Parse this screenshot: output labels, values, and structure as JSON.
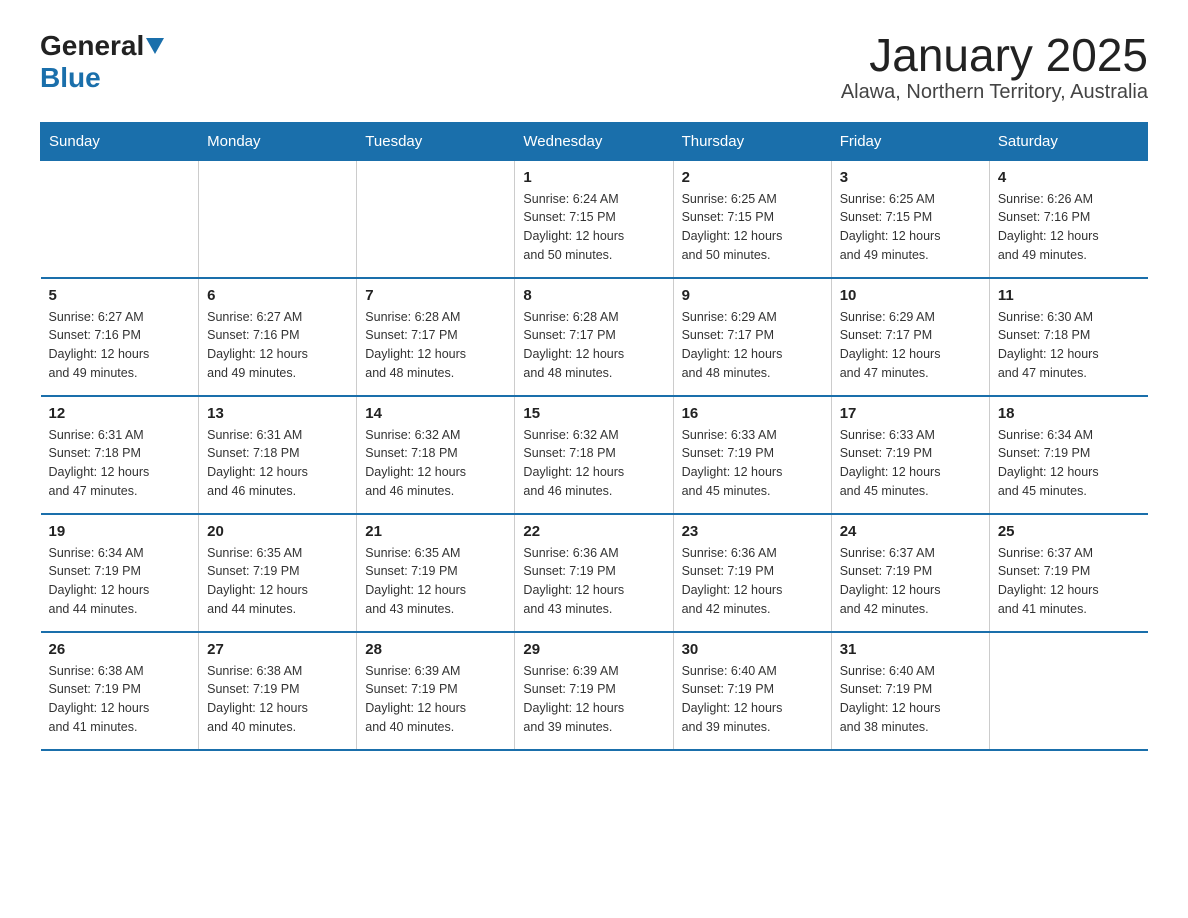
{
  "header": {
    "logo_general": "General",
    "logo_blue": "Blue",
    "title": "January 2025",
    "subtitle": "Alawa, Northern Territory, Australia"
  },
  "days_of_week": [
    "Sunday",
    "Monday",
    "Tuesday",
    "Wednesday",
    "Thursday",
    "Friday",
    "Saturday"
  ],
  "weeks": [
    [
      {
        "day": "",
        "info": ""
      },
      {
        "day": "",
        "info": ""
      },
      {
        "day": "",
        "info": ""
      },
      {
        "day": "1",
        "info": "Sunrise: 6:24 AM\nSunset: 7:15 PM\nDaylight: 12 hours\nand 50 minutes."
      },
      {
        "day": "2",
        "info": "Sunrise: 6:25 AM\nSunset: 7:15 PM\nDaylight: 12 hours\nand 50 minutes."
      },
      {
        "day": "3",
        "info": "Sunrise: 6:25 AM\nSunset: 7:15 PM\nDaylight: 12 hours\nand 49 minutes."
      },
      {
        "day": "4",
        "info": "Sunrise: 6:26 AM\nSunset: 7:16 PM\nDaylight: 12 hours\nand 49 minutes."
      }
    ],
    [
      {
        "day": "5",
        "info": "Sunrise: 6:27 AM\nSunset: 7:16 PM\nDaylight: 12 hours\nand 49 minutes."
      },
      {
        "day": "6",
        "info": "Sunrise: 6:27 AM\nSunset: 7:16 PM\nDaylight: 12 hours\nand 49 minutes."
      },
      {
        "day": "7",
        "info": "Sunrise: 6:28 AM\nSunset: 7:17 PM\nDaylight: 12 hours\nand 48 minutes."
      },
      {
        "day": "8",
        "info": "Sunrise: 6:28 AM\nSunset: 7:17 PM\nDaylight: 12 hours\nand 48 minutes."
      },
      {
        "day": "9",
        "info": "Sunrise: 6:29 AM\nSunset: 7:17 PM\nDaylight: 12 hours\nand 48 minutes."
      },
      {
        "day": "10",
        "info": "Sunrise: 6:29 AM\nSunset: 7:17 PM\nDaylight: 12 hours\nand 47 minutes."
      },
      {
        "day": "11",
        "info": "Sunrise: 6:30 AM\nSunset: 7:18 PM\nDaylight: 12 hours\nand 47 minutes."
      }
    ],
    [
      {
        "day": "12",
        "info": "Sunrise: 6:31 AM\nSunset: 7:18 PM\nDaylight: 12 hours\nand 47 minutes."
      },
      {
        "day": "13",
        "info": "Sunrise: 6:31 AM\nSunset: 7:18 PM\nDaylight: 12 hours\nand 46 minutes."
      },
      {
        "day": "14",
        "info": "Sunrise: 6:32 AM\nSunset: 7:18 PM\nDaylight: 12 hours\nand 46 minutes."
      },
      {
        "day": "15",
        "info": "Sunrise: 6:32 AM\nSunset: 7:18 PM\nDaylight: 12 hours\nand 46 minutes."
      },
      {
        "day": "16",
        "info": "Sunrise: 6:33 AM\nSunset: 7:19 PM\nDaylight: 12 hours\nand 45 minutes."
      },
      {
        "day": "17",
        "info": "Sunrise: 6:33 AM\nSunset: 7:19 PM\nDaylight: 12 hours\nand 45 minutes."
      },
      {
        "day": "18",
        "info": "Sunrise: 6:34 AM\nSunset: 7:19 PM\nDaylight: 12 hours\nand 45 minutes."
      }
    ],
    [
      {
        "day": "19",
        "info": "Sunrise: 6:34 AM\nSunset: 7:19 PM\nDaylight: 12 hours\nand 44 minutes."
      },
      {
        "day": "20",
        "info": "Sunrise: 6:35 AM\nSunset: 7:19 PM\nDaylight: 12 hours\nand 44 minutes."
      },
      {
        "day": "21",
        "info": "Sunrise: 6:35 AM\nSunset: 7:19 PM\nDaylight: 12 hours\nand 43 minutes."
      },
      {
        "day": "22",
        "info": "Sunrise: 6:36 AM\nSunset: 7:19 PM\nDaylight: 12 hours\nand 43 minutes."
      },
      {
        "day": "23",
        "info": "Sunrise: 6:36 AM\nSunset: 7:19 PM\nDaylight: 12 hours\nand 42 minutes."
      },
      {
        "day": "24",
        "info": "Sunrise: 6:37 AM\nSunset: 7:19 PM\nDaylight: 12 hours\nand 42 minutes."
      },
      {
        "day": "25",
        "info": "Sunrise: 6:37 AM\nSunset: 7:19 PM\nDaylight: 12 hours\nand 41 minutes."
      }
    ],
    [
      {
        "day": "26",
        "info": "Sunrise: 6:38 AM\nSunset: 7:19 PM\nDaylight: 12 hours\nand 41 minutes."
      },
      {
        "day": "27",
        "info": "Sunrise: 6:38 AM\nSunset: 7:19 PM\nDaylight: 12 hours\nand 40 minutes."
      },
      {
        "day": "28",
        "info": "Sunrise: 6:39 AM\nSunset: 7:19 PM\nDaylight: 12 hours\nand 40 minutes."
      },
      {
        "day": "29",
        "info": "Sunrise: 6:39 AM\nSunset: 7:19 PM\nDaylight: 12 hours\nand 39 minutes."
      },
      {
        "day": "30",
        "info": "Sunrise: 6:40 AM\nSunset: 7:19 PM\nDaylight: 12 hours\nand 39 minutes."
      },
      {
        "day": "31",
        "info": "Sunrise: 6:40 AM\nSunset: 7:19 PM\nDaylight: 12 hours\nand 38 minutes."
      },
      {
        "day": "",
        "info": ""
      }
    ]
  ]
}
